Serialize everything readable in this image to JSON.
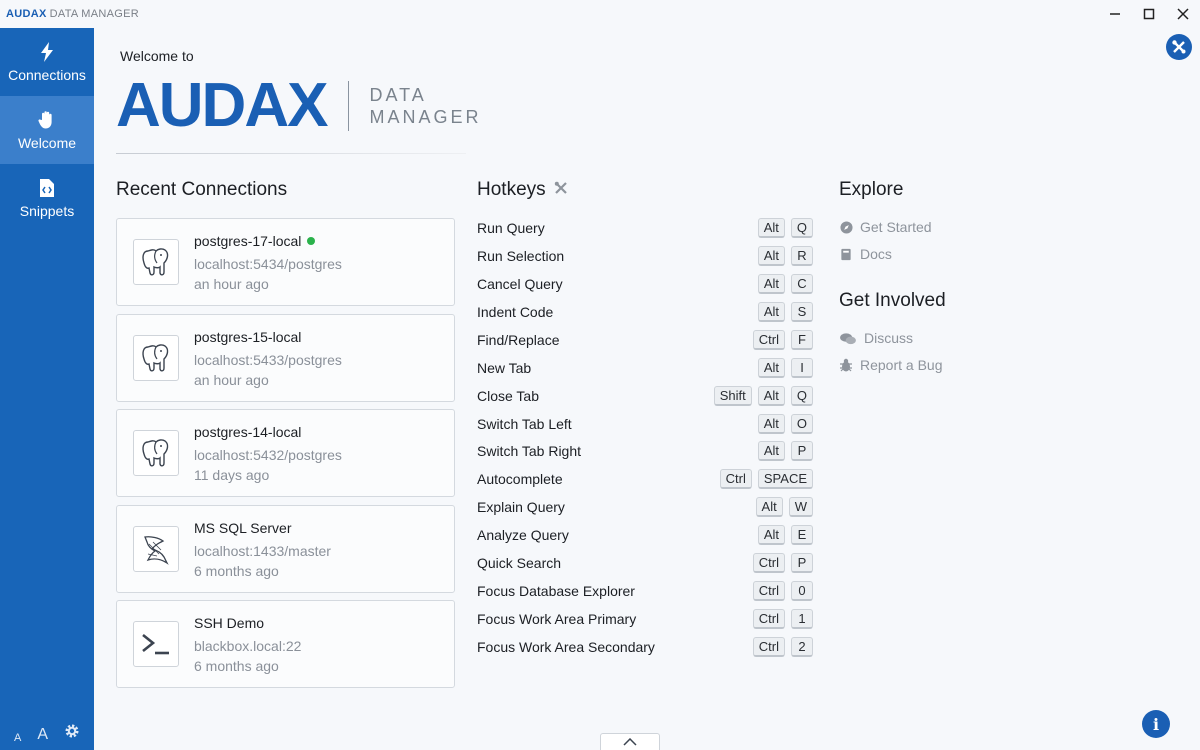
{
  "titlebar": {
    "brand_bold": "AUDAX",
    "brand_rest": "DATA MANAGER"
  },
  "sidebar": {
    "items": [
      {
        "label": "Connections",
        "icon": "bolt-icon",
        "active": false
      },
      {
        "label": "Welcome",
        "icon": "wave-hand-icon",
        "active": true
      },
      {
        "label": "Snippets",
        "icon": "code-file-icon",
        "active": false
      }
    ],
    "font_small": "A",
    "font_large": "A"
  },
  "welcome": {
    "intro": "Welcome to",
    "logo_big": "AUDAX",
    "logo_line1": "DATA",
    "logo_line2": "MANAGER"
  },
  "recent": {
    "title": "Recent Connections",
    "items": [
      {
        "name": "postgres-17-local",
        "host": "localhost:5434/postgres",
        "when": "an hour ago",
        "icon": "postgres-elephant-icon",
        "connected": true
      },
      {
        "name": "postgres-15-local",
        "host": "localhost:5433/postgres",
        "when": "an hour ago",
        "icon": "postgres-elephant-icon",
        "connected": false
      },
      {
        "name": "postgres-14-local",
        "host": "localhost:5432/postgres",
        "when": "11 days ago",
        "icon": "postgres-elephant-icon",
        "connected": false
      },
      {
        "name": "MS SQL Server",
        "host": "localhost:1433/master",
        "when": "6 months ago",
        "icon": "mssql-icon",
        "connected": false
      },
      {
        "name": "SSH Demo",
        "host": "blackbox.local:22",
        "when": "6 months ago",
        "icon": "terminal-icon",
        "connected": false
      }
    ]
  },
  "hotkeys": {
    "title": "Hotkeys",
    "items": [
      {
        "label": "Run Query",
        "keys": [
          "Alt",
          "Q"
        ]
      },
      {
        "label": "Run Selection",
        "keys": [
          "Alt",
          "R"
        ]
      },
      {
        "label": "Cancel Query",
        "keys": [
          "Alt",
          "C"
        ]
      },
      {
        "label": "Indent Code",
        "keys": [
          "Alt",
          "S"
        ]
      },
      {
        "label": "Find/Replace",
        "keys": [
          "Ctrl",
          "F"
        ]
      },
      {
        "label": "New Tab",
        "keys": [
          "Alt",
          "I"
        ]
      },
      {
        "label": "Close Tab",
        "keys": [
          "Shift",
          "Alt",
          "Q"
        ]
      },
      {
        "label": "Switch Tab Left",
        "keys": [
          "Alt",
          "O"
        ]
      },
      {
        "label": "Switch Tab Right",
        "keys": [
          "Alt",
          "P"
        ]
      },
      {
        "label": "Autocomplete",
        "keys": [
          "Ctrl",
          "SPACE"
        ]
      },
      {
        "label": "Explain Query",
        "keys": [
          "Alt",
          "W"
        ]
      },
      {
        "label": "Analyze Query",
        "keys": [
          "Alt",
          "E"
        ]
      },
      {
        "label": "Quick Search",
        "keys": [
          "Ctrl",
          "P"
        ]
      },
      {
        "label": "Focus Database Explorer",
        "keys": [
          "Ctrl",
          "0"
        ]
      },
      {
        "label": "Focus Work Area Primary",
        "keys": [
          "Ctrl",
          "1"
        ]
      },
      {
        "label": "Focus Work Area Secondary",
        "keys": [
          "Ctrl",
          "2"
        ]
      }
    ]
  },
  "explore": {
    "title": "Explore",
    "links": [
      {
        "label": "Get Started",
        "icon": "compass-icon"
      },
      {
        "label": "Docs",
        "icon": "book-icon"
      }
    ]
  },
  "involved": {
    "title": "Get Involved",
    "links": [
      {
        "label": "Discuss",
        "icon": "comments-icon"
      },
      {
        "label": "Report a Bug",
        "icon": "bug-icon"
      }
    ]
  },
  "colors": {
    "brand": "#1a5fb4",
    "sidebar": "#1865b8",
    "sidebar_active": "#3b7fcb",
    "connected": "#2bb24c"
  }
}
